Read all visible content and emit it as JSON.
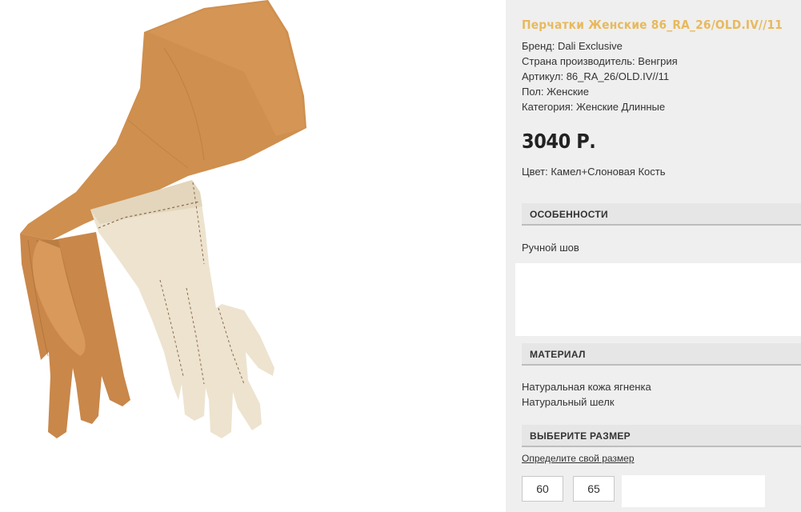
{
  "product": {
    "title": "Перчатки Женские 86_RA_26/OLD.IV//11",
    "brand": "Бренд: Dali Exclusive",
    "country": "Страна производитель: Венгрия",
    "article": "Артикул: 86_RA_26/OLD.IV//11",
    "gender": "Пол: Женские",
    "category": "Категория: Женские Длинные",
    "price": "3040 Р.",
    "color": "Цвет: Камел+Слоновая Кость"
  },
  "features": {
    "heading": "ОСОБЕННОСТИ",
    "text": "Ручной шов"
  },
  "material": {
    "heading": "МАТЕРИАЛ",
    "line1": "Натуральная кожа ягненка",
    "line2": "Натуральный шелк"
  },
  "size": {
    "heading": "ВЫБЕРИТЕ РАЗМЕР",
    "link": "Определите свой размер",
    "options": [
      "60",
      "65"
    ]
  },
  "colors": {
    "title": "#e8b95c",
    "panel_bg": "#efefef",
    "glove_camel": "#cf8f4e",
    "glove_ivory": "#ede3cf"
  }
}
